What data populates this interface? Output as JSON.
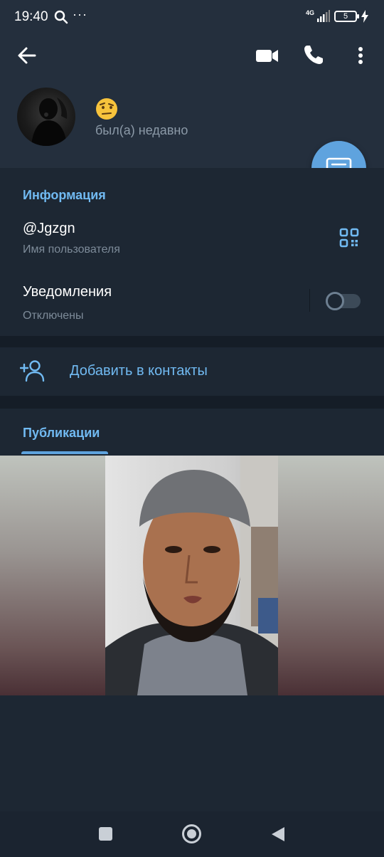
{
  "status_bar": {
    "time": "19:40",
    "network": "4G",
    "battery": "5"
  },
  "header": {
    "back_icon": "arrow-left-icon",
    "video_icon": "video-camera-icon",
    "call_icon": "phone-icon",
    "more_icon": "more-vertical-icon"
  },
  "profile": {
    "emoji": "🤨",
    "status": "был(а) недавно"
  },
  "fab_icon": "message-icon",
  "info": {
    "title": "Информация",
    "username": "@Jgzgn",
    "username_label": "Имя пользователя",
    "notifications_label": "Уведомления",
    "notifications_value": "Отключены",
    "notifications_enabled": false
  },
  "add_contact": {
    "label": "Добавить в контакты"
  },
  "publications": {
    "tab_label": "Публикации"
  },
  "colors": {
    "background": "#1d2733",
    "header": "#242f3d",
    "accent": "#71baf2",
    "fab": "#5fa3de"
  }
}
